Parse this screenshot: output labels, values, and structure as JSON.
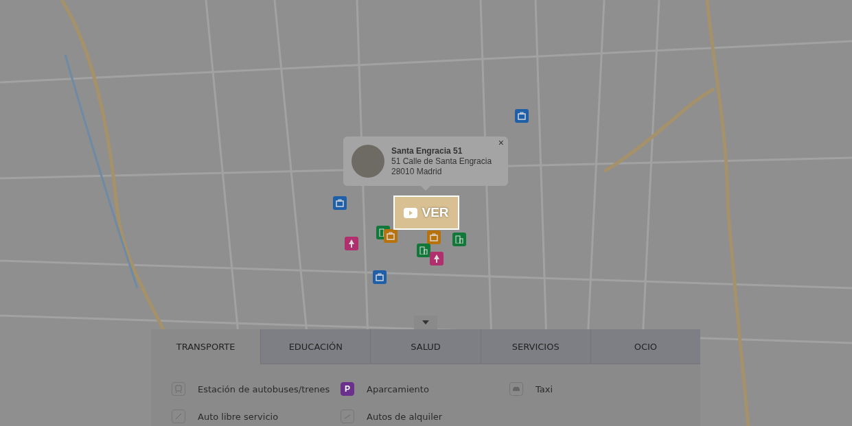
{
  "map": {
    "pins": [
      {
        "kind": "briefcase",
        "color": "#1f5fa8"
      },
      {
        "kind": "briefcase",
        "color": "#1f5fa8"
      },
      {
        "kind": "briefcase",
        "color": "#1f5fa8"
      },
      {
        "kind": "tree",
        "color": "#b0306e"
      },
      {
        "kind": "building",
        "color": "#12783a"
      },
      {
        "kind": "briefcase",
        "color": "#b8720c"
      },
      {
        "kind": "briefcase",
        "color": "#b8720c"
      },
      {
        "kind": "building",
        "color": "#12783a"
      },
      {
        "kind": "building",
        "color": "#12783a"
      },
      {
        "kind": "tree",
        "color": "#b0306e"
      }
    ]
  },
  "popup": {
    "title": "Santa Engracia 51",
    "address_line_1": "51 Calle de Santa Engracia",
    "address_line_2": "28010 Madrid",
    "close": "×"
  },
  "video_button": {
    "label": "VER"
  },
  "panel": {
    "tabs": [
      {
        "label": "TRANSPORTE",
        "selected": true
      },
      {
        "label": "EDUCACIÓN",
        "selected": false
      },
      {
        "label": "SALUD",
        "selected": false
      },
      {
        "label": "SERVICIOS",
        "selected": false
      },
      {
        "label": "OCIO",
        "selected": false
      }
    ],
    "items": [
      {
        "kind": "bus",
        "label": "Estación de autobuses/trenes",
        "selected": false
      },
      {
        "kind": "parking",
        "label": "Aparcamiento",
        "glyph": "P",
        "selected": true
      },
      {
        "kind": "taxi",
        "label": "Taxi",
        "selected": false
      },
      {
        "kind": "bike",
        "label": "Auto libre servicio",
        "selected": false
      },
      {
        "kind": "rental",
        "label": "Autos de alquiler",
        "selected": false
      }
    ]
  }
}
